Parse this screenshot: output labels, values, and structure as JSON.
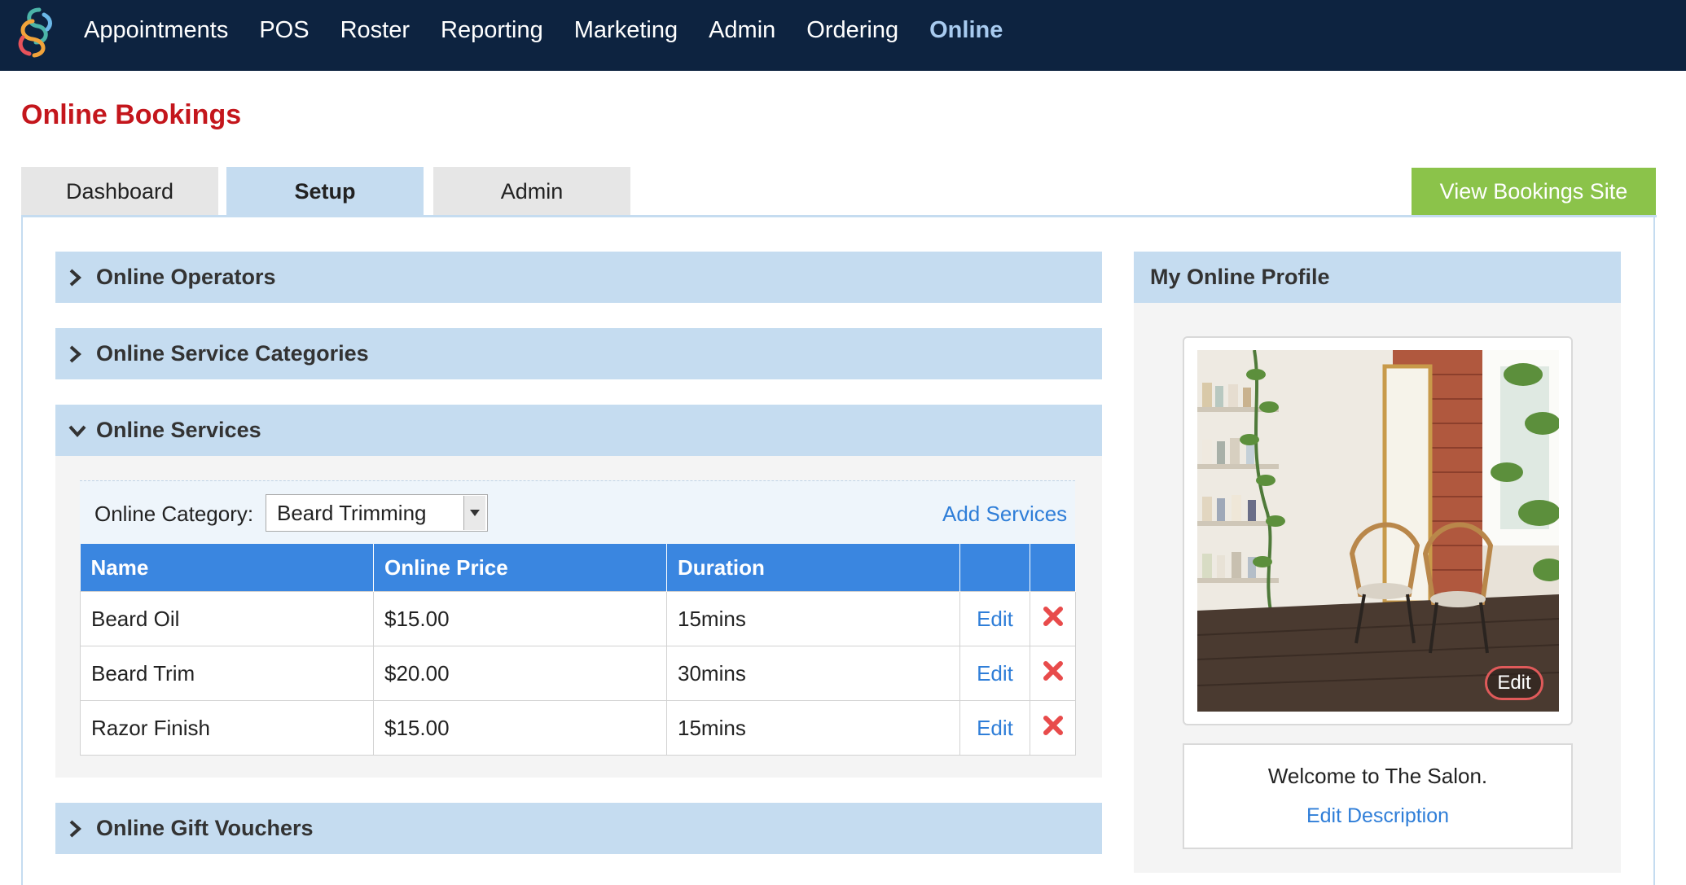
{
  "nav": {
    "items": [
      {
        "label": "Appointments",
        "active": false
      },
      {
        "label": "POS",
        "active": false
      },
      {
        "label": "Roster",
        "active": false
      },
      {
        "label": "Reporting",
        "active": false
      },
      {
        "label": "Marketing",
        "active": false
      },
      {
        "label": "Admin",
        "active": false
      },
      {
        "label": "Ordering",
        "active": false
      },
      {
        "label": "Online",
        "active": true
      }
    ]
  },
  "page": {
    "title": "Online Bookings"
  },
  "tabs": [
    {
      "label": "Dashboard",
      "active": false
    },
    {
      "label": "Setup",
      "active": true
    },
    {
      "label": "Admin",
      "active": false
    }
  ],
  "view_site_label": "View Bookings Site",
  "sections": {
    "operators": "Online Operators",
    "categories": "Online Service Categories",
    "services": "Online Services",
    "vouchers": "Online Gift Vouchers"
  },
  "services": {
    "filter_label": "Online Category:",
    "selected_category": "Beard Trimming",
    "add_label": "Add Services",
    "columns": [
      "Name",
      "Online Price",
      "Duration"
    ],
    "rows": [
      {
        "name": "Beard Oil",
        "price": "$15.00",
        "duration": "15mins",
        "edit": "Edit"
      },
      {
        "name": "Beard Trim",
        "price": "$20.00",
        "duration": "30mins",
        "edit": "Edit"
      },
      {
        "name": "Razor Finish",
        "price": "$15.00",
        "duration": "15mins",
        "edit": "Edit"
      }
    ]
  },
  "profile": {
    "title": "My Online Profile",
    "photo_edit_label": "Edit",
    "description": "Welcome to The Salon.",
    "edit_description_label": "Edit Description"
  },
  "colors": {
    "topbar": "#0d2340",
    "title_red": "#c4161c",
    "accent_blue": "#3a86e0",
    "link_blue": "#2f7ed8",
    "panel_blue": "#c5dcf0",
    "green_button": "#8bc34a",
    "delete_red": "#e84b4b"
  }
}
